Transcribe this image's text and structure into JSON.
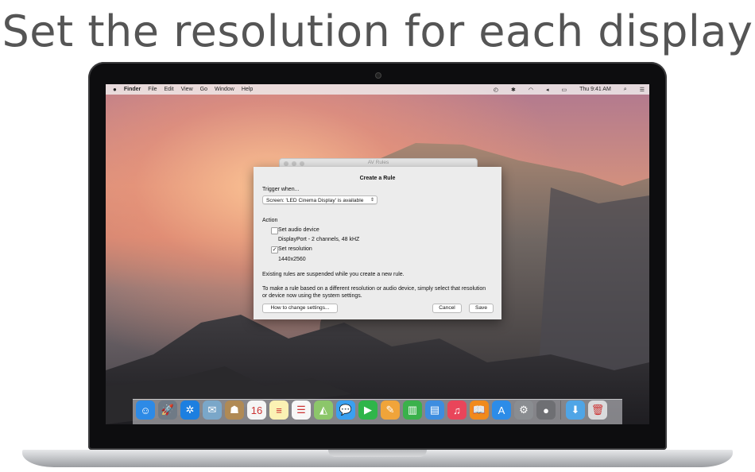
{
  "headline": "Set the resolution for each display",
  "menubar": {
    "apple": "",
    "app": "Finder",
    "items": [
      "File",
      "Edit",
      "View",
      "Go",
      "Window",
      "Help"
    ],
    "status_icons": [
      "time-machine-icon",
      "bluetooth-icon",
      "wifi-icon",
      "volume-icon",
      "battery-icon"
    ],
    "clock": "Thu 9:41 AM"
  },
  "background_window": {
    "title": "AV Rules"
  },
  "dialog": {
    "title": "Create a Rule",
    "trigger_label": "Trigger when...",
    "trigger_value": "Screen: 'LED Cinema Display' is available",
    "action_label": "Action",
    "audio": {
      "label": "Set audio device",
      "checked": false,
      "value": "DisplayPort - 2 channels, 48 kHZ"
    },
    "resolution": {
      "label": "Set resolution",
      "checked": true,
      "value": "1440x2560"
    },
    "note1": "Existing rules are suspended while you create a new rule.",
    "note2_line1": "To make a rule based on a different resolution or audio device, simply select that resolution",
    "note2_line2": "or device now using the system settings.",
    "help_button": "How to change settings...",
    "cancel_button": "Cancel",
    "save_button": "Save"
  },
  "dock": {
    "icons": [
      {
        "name": "finder-icon",
        "color": "#2d8ae6",
        "glyph": "☺"
      },
      {
        "name": "launchpad-icon",
        "color": "#6f7a86",
        "glyph": "🚀"
      },
      {
        "name": "safari-icon",
        "color": "#1d7fe0",
        "glyph": "✲"
      },
      {
        "name": "mail-stamp-icon",
        "color": "#7aa7c9",
        "glyph": "✉"
      },
      {
        "name": "contacts-icon",
        "color": "#b08a55",
        "glyph": "☗"
      },
      {
        "name": "calendar-icon",
        "color": "#f5f5f5",
        "glyph": "16"
      },
      {
        "name": "notes-icon",
        "color": "#fbf2b4",
        "glyph": "≡"
      },
      {
        "name": "reminders-icon",
        "color": "#f7f7f7",
        "glyph": "☰"
      },
      {
        "name": "maps-icon",
        "color": "#8cc66a",
        "glyph": "◭"
      },
      {
        "name": "messages-icon",
        "color": "#3aa0f0",
        "glyph": "💬"
      },
      {
        "name": "facetime-icon",
        "color": "#2fb54a",
        "glyph": "▶"
      },
      {
        "name": "pages-icon",
        "color": "#f0a43a",
        "glyph": "✎"
      },
      {
        "name": "numbers-icon",
        "color": "#3ab14b",
        "glyph": "▥"
      },
      {
        "name": "keynote-icon",
        "color": "#3d8de0",
        "glyph": "▤"
      },
      {
        "name": "itunes-icon",
        "color": "#e9455a",
        "glyph": "♫"
      },
      {
        "name": "ibooks-icon",
        "color": "#f08a1c",
        "glyph": "📖"
      },
      {
        "name": "app-store-icon",
        "color": "#2c8ce8",
        "glyph": "A"
      },
      {
        "name": "system-preferences-icon",
        "color": "#8a8d91",
        "glyph": "⚙"
      },
      {
        "name": "app-icon",
        "color": "#6e6f73",
        "glyph": "●"
      },
      {
        "name": "downloads-folder-icon",
        "color": "#4fa5e6",
        "glyph": "⬇"
      },
      {
        "name": "trash-icon",
        "color": "#d9dadc",
        "glyph": "🗑"
      }
    ]
  }
}
